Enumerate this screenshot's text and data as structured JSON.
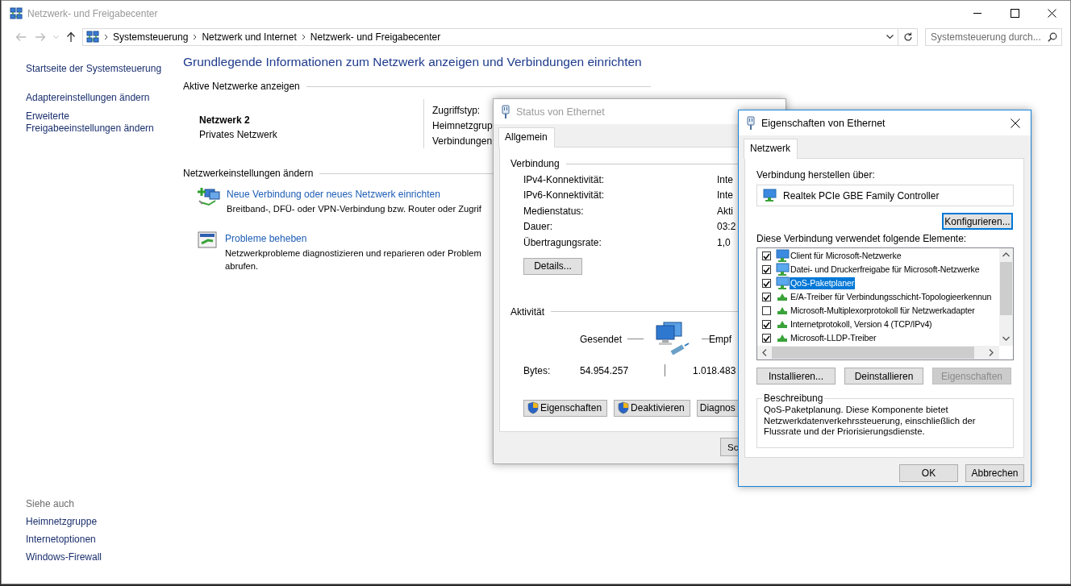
{
  "window": {
    "title": "Netzwerk- und Freigabecenter",
    "active": false
  },
  "address_bar": {
    "breadcrumb": [
      "Systemsteuerung",
      "Netzwerk und Internet",
      "Netzwerk- und Freigabecenter"
    ]
  },
  "search": {
    "placeholder": "Systemsteuerung durch..."
  },
  "sidebar": {
    "links": [
      "Startseite der Systemsteuerung",
      "Adaptereinstellungen ändern",
      "Erweiterte Freigabeeinstellungen ändern"
    ],
    "see_also_title": "Siehe auch",
    "see_also_links": [
      "Heimnetzgruppe",
      "Internetoptionen",
      "Windows-Firewall"
    ]
  },
  "main": {
    "heading": "Grundlegende Informationen zum Netzwerk anzeigen und Verbindungen einrichten",
    "active_networks": {
      "title": "Aktive Netzwerke anzeigen",
      "network_name": "Netzwerk 2",
      "network_type": "Privates Netzwerk",
      "details": [
        "Zugriffstyp:",
        "Heimnetzgrup",
        "Verbindungen"
      ]
    },
    "settings": {
      "title": "Netzwerkeinstellungen ändern",
      "tasks": [
        {
          "kind": "new-connection",
          "link": "Neue Verbindung oder neues Netzwerk einrichten",
          "lines": [
            "Breitband-, DFÜ- oder VPN-Verbindung bzw. Router oder Zugrif"
          ]
        },
        {
          "kind": "troubleshoot",
          "link": "Probleme beheben",
          "lines": [
            "Netzwerkprobleme diagnostizieren und reparieren oder Problem",
            "abrufen."
          ]
        }
      ]
    }
  },
  "status_dialog": {
    "title": "Status von Ethernet",
    "active": false,
    "tabs": [
      {
        "label": "Allgemein",
        "selected": true
      }
    ],
    "connection": {
      "title": "Verbindung",
      "rows": [
        {
          "label": "IPv4-Konnektivität:",
          "value": "Inte"
        },
        {
          "label": "IPv6-Konnektivität:",
          "value": "Inte"
        },
        {
          "label": "Medienstatus:",
          "value": "Akti"
        },
        {
          "label": "Dauer:",
          "value": "03:2"
        },
        {
          "label": "Übertragungsrate:",
          "value": "1,0"
        }
      ],
      "details_button": "Details..."
    },
    "activity": {
      "title": "Aktivität",
      "sent_label": "Gesendet",
      "received_label": "Empf",
      "bytes_label": "Bytes:",
      "bytes_sent": "54.954.257",
      "bytes_received": "1.018.483"
    },
    "buttons": [
      {
        "label": "Eigenschaften",
        "shield": true
      },
      {
        "label": "Deaktivieren",
        "shield": true
      },
      {
        "label": "Diagnos",
        "shield": false
      }
    ],
    "close_button": "Sc"
  },
  "properties_dialog": {
    "title": "Eigenschaften von Ethernet",
    "active": true,
    "tabs": [
      {
        "label": "Netzwerk",
        "selected": true
      }
    ],
    "connect_using_label": "Verbindung herstellen über:",
    "adapter": "Realtek PCIe GBE Family Controller",
    "configure_button": {
      "label": "Konfigurieren...",
      "focused": true
    },
    "items_label": "Diese Verbindung verwendet folgende Elemente:",
    "items": [
      {
        "kind": "client",
        "label": "Client für Microsoft-Netzwerke",
        "checked": true,
        "selected": false
      },
      {
        "kind": "service",
        "label": "Datei- und Druckerfreigabe für Microsoft-Netzwerke",
        "checked": true,
        "selected": false
      },
      {
        "kind": "service",
        "label": "QoS-Paketplaner",
        "checked": true,
        "selected": true
      },
      {
        "kind": "protocol",
        "label": "E/A-Treiber für Verbindungsschicht-Topologieerkennun",
        "checked": true,
        "selected": false
      },
      {
        "kind": "protocol",
        "label": "Microsoft-Multiplexorprotokoll für Netzwerkadapter",
        "checked": false,
        "selected": false
      },
      {
        "kind": "protocol",
        "label": "Internetprotokoll, Version 4 (TCP/IPv4)",
        "checked": true,
        "selected": false
      },
      {
        "kind": "protocol",
        "label": "Microsoft-LLDP-Treiber",
        "checked": true,
        "selected": false
      }
    ],
    "buttons": [
      {
        "label": "Installieren...",
        "disabled": false
      },
      {
        "label": "Deinstallieren",
        "disabled": false
      },
      {
        "label": "Eigenschaften",
        "disabled": true
      }
    ],
    "description": {
      "title": "Beschreibung",
      "text": "QoS-Paketplanung. Diese Komponente bietet Netzwerkdatenverkehrssteuerung, einschließlich der Flussrate und der Priorisierungsdienste."
    },
    "dialog_buttons": [
      "OK",
      "Abbrechen"
    ]
  }
}
